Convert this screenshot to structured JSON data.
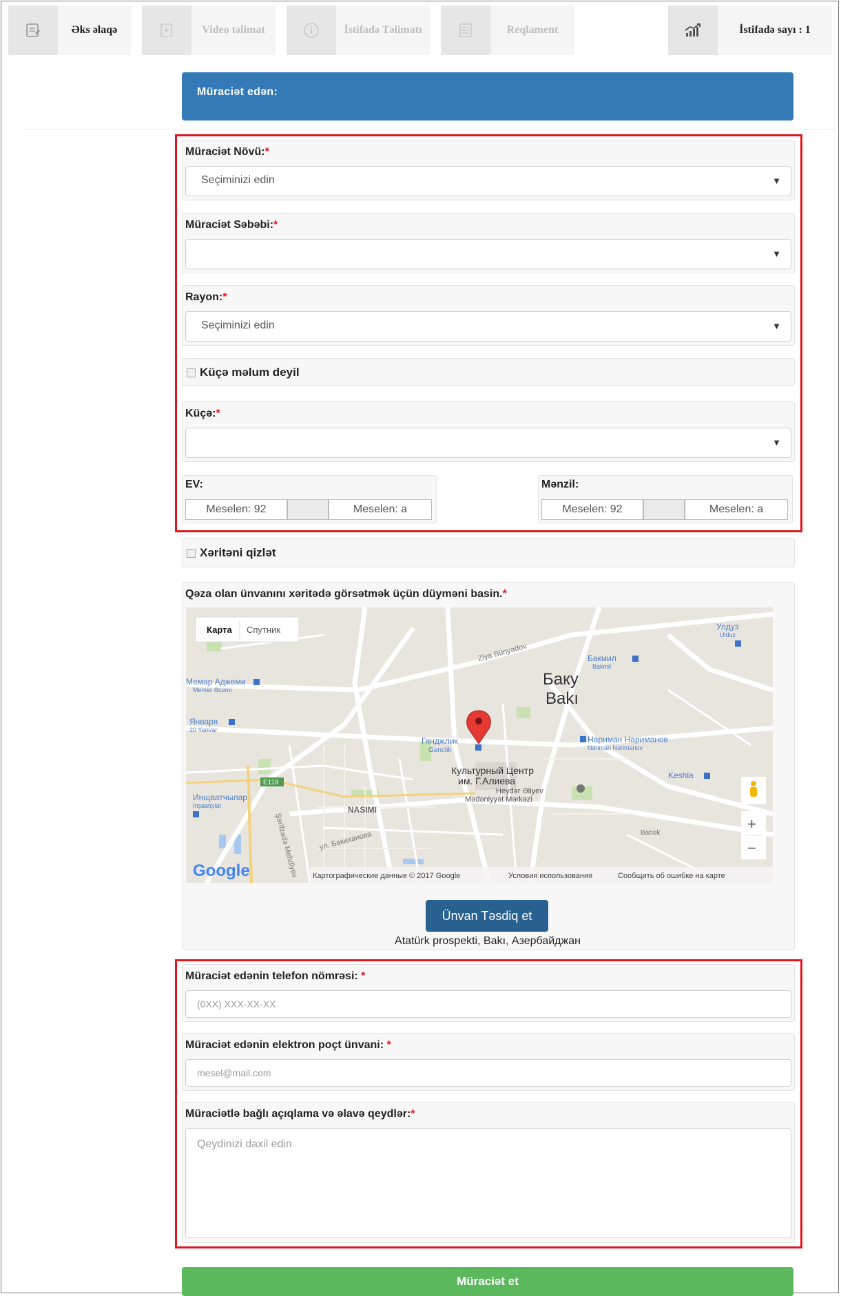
{
  "nav": {
    "tabs": [
      {
        "label": "Əks əlaqə",
        "icon": "feedback-icon"
      },
      {
        "label": "Video təlimat",
        "icon": "video-icon"
      },
      {
        "label": "İstifadə Təlimatı",
        "icon": "info-icon"
      },
      {
        "label": "Reqlament",
        "icon": "document-icon"
      },
      {
        "label": "İstifadə sayı : 1",
        "icon": "chart-icon"
      }
    ]
  },
  "panel": {
    "title": "Müraciət edən:"
  },
  "form": {
    "type": {
      "label": "Müraciət Növü:",
      "value": "Seçiminizi edin"
    },
    "reason": {
      "label": "Müraciət Səbəbi:",
      "value": ""
    },
    "district": {
      "label": "Rayon:",
      "value": "Seçiminizi edin"
    },
    "street_unknown": {
      "label": "Küçə məlum deyil"
    },
    "street": {
      "label": "Küçə:",
      "value": ""
    },
    "house": {
      "label": "EV:",
      "placeholder_number": "Meselen: 92",
      "placeholder_letter": "Meselen: a"
    },
    "apartment": {
      "label": "Mənzil:",
      "placeholder_number": "Meselen: 92",
      "placeholder_letter": "Meselen: a"
    },
    "hide_map": {
      "label": "Xəritəni qizlət"
    },
    "map_prompt": "Qəza olan ünvanını xəritədə görsətmək üçün düyməni basin.",
    "required_mark": "*"
  },
  "map": {
    "type_buttons": [
      "Карта",
      "Спутник"
    ],
    "labels": {
      "city_ru": "Баку",
      "city_az": "Bakı",
      "metro1": "Гянджлик",
      "metro1_az": "Gənclik",
      "metro2": "Нариман Нариманов",
      "metro2_az": "Nəriman Nərimanov",
      "metro3": "Бакмил",
      "metro3_az": "Bakmil",
      "metro4": "Мемар Аджеми",
      "metro4_az": "Memar Əcəmi",
      "metro5": "Января",
      "metro5_az": "20 Yanvar",
      "metro6": "Улдуз",
      "metro6_az": "Ulduz",
      "metro7": "Инщаатчылар",
      "metro7_az": "İnşaatçılar",
      "metro8": "Keshla",
      "center1": "Культурный Центр",
      "center2": "им. Г.Алиева",
      "center3": "Heydər Əliyev",
      "center4": "Mədəniyyət Mərkəzi",
      "nasimi": "NASIMI",
      "road1": "Ziya Bünyadov",
      "road2": "Babək",
      "road3": "E119",
      "road4": "ул. Бакиханова",
      "road5": "Şərifzadə Mehdiyev"
    },
    "logo": "Google",
    "attribution": "Картографические данные © 2017 Google",
    "terms": "Условия использования",
    "report": "Сообщить об ошибке на карте",
    "zoom_in": "+",
    "zoom_out": "−"
  },
  "confirm": {
    "button": "Ünvan Təsdiq et",
    "address": "Atatürk prospekti, Bakı, Азербайджан"
  },
  "contact": {
    "phone": {
      "label": "Müraciət edənin telefon nömrəsi:",
      "placeholder": "(0XX) XXX-XX-XX"
    },
    "email": {
      "label": "Müraciət edənin elektron poçt ünvani:",
      "placeholder": "mesel@mail.com"
    },
    "notes": {
      "label": "Müraciətlə bağlı açıqlama və əlavə qeydlər:",
      "placeholder": "Qeydinizi daxil edin"
    }
  },
  "submit": {
    "label": "Müraciət et"
  },
  "colors": {
    "primary": "#337ab7",
    "confirm": "#286090",
    "success": "#5cb85c",
    "highlight": "#e0161f"
  }
}
